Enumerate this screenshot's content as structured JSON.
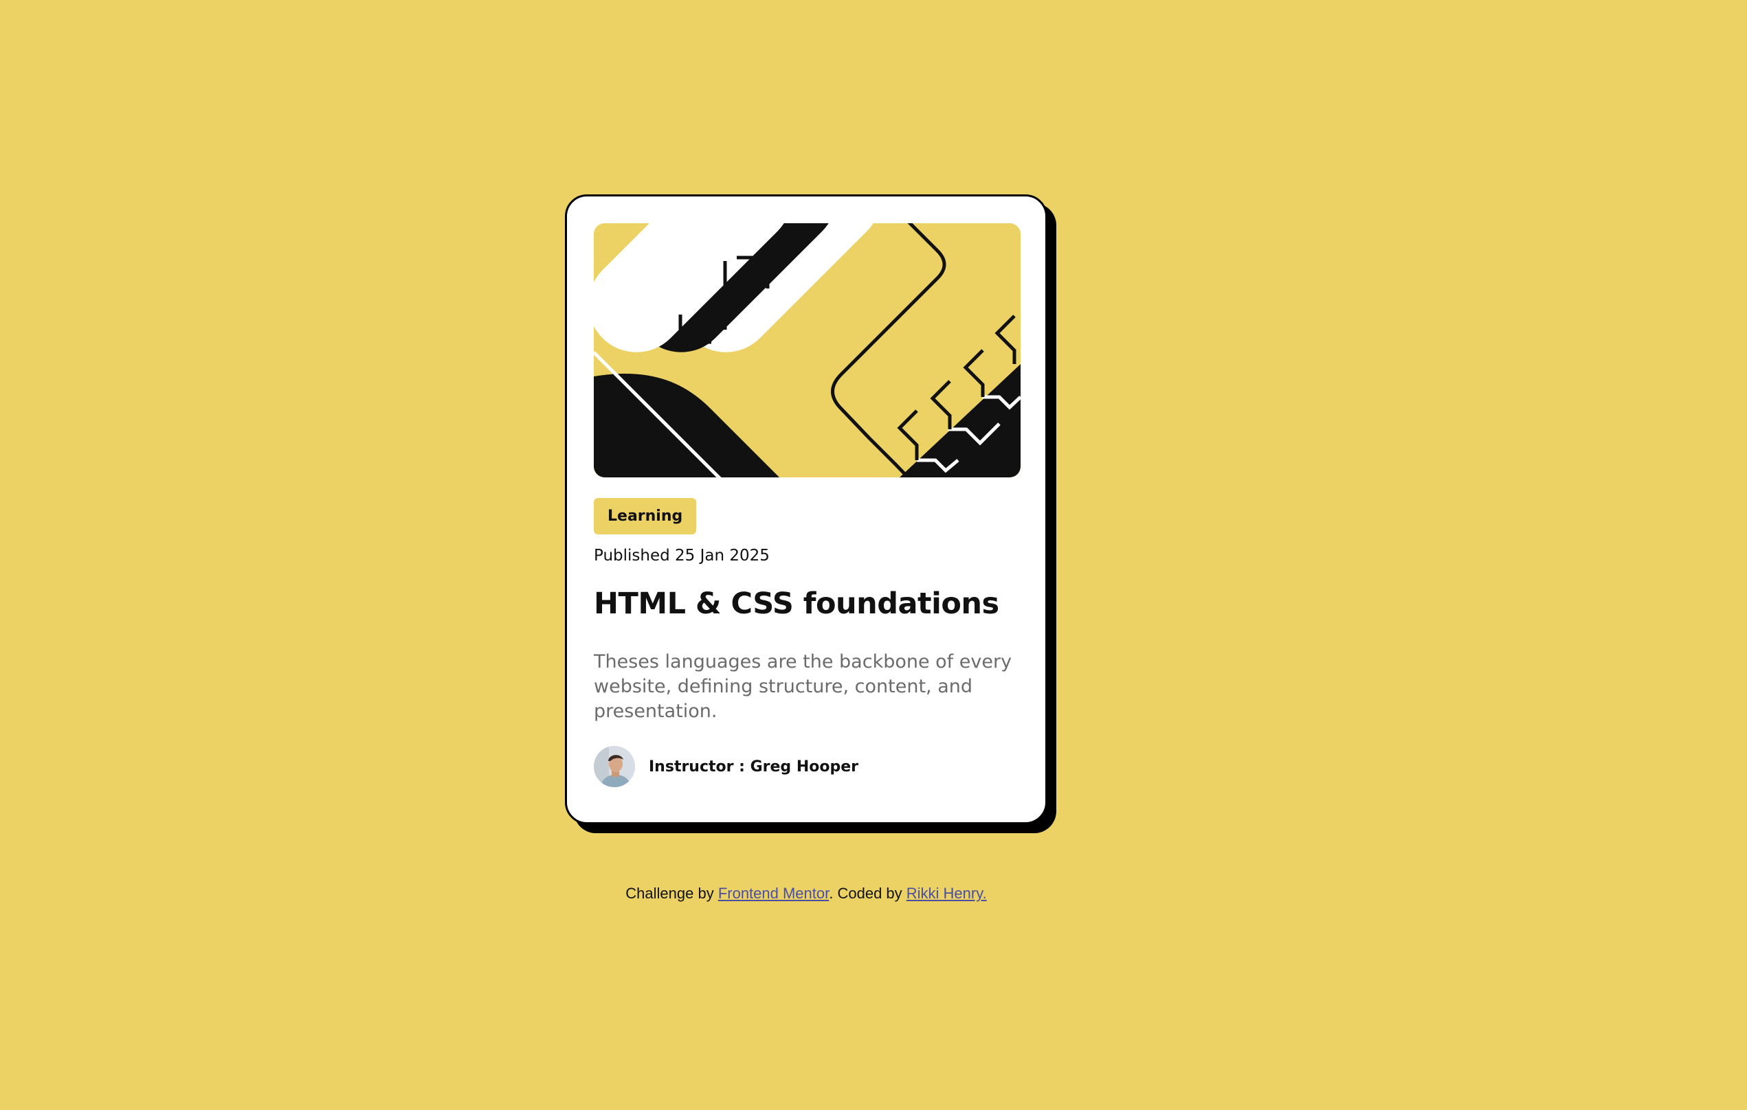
{
  "card": {
    "category": "Learning",
    "published": "Published 25 Jan 2025",
    "title": "HTML & CSS foundations",
    "description": "Theses languages are the backbone of every website, defining structure, content, and presentation.",
    "author": "Instructor : Greg Hooper"
  },
  "attribution": {
    "prefix": "Challenge by ",
    "link1": "Frontend Mentor",
    "middle": ". Coded by ",
    "link2": "Rikki Henry."
  },
  "colors": {
    "background": "#ecd265",
    "card": "#ffffff",
    "text": "#111111",
    "muted_text": "#6b6b6b",
    "link": "#4a4ea3"
  },
  "icons": {
    "hero": "abstract-code-illustration",
    "avatar": "instructor-portrait"
  }
}
